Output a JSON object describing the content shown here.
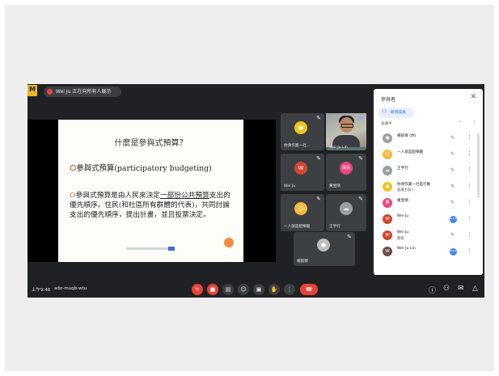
{
  "window": {
    "logo": "M",
    "presenting_label": "Wei Ju 正在向所有人展示"
  },
  "slide": {
    "title": "什麼是參與式預算？",
    "bullet1": "參與式預算(participatory budgeting)",
    "bullet2_a": "參與式預算是由人民來決定",
    "bullet2_link": "一部份公共預算",
    "bullet2_b": "支出的優先順序。住民(和社區所有群體的代表)，共同討論支出的優先順序，提出計畫，並且投票決定。"
  },
  "tiles": [
    {
      "name": "你滑作業一社...",
      "avatar": "",
      "avatar_color": "#f0c419"
    },
    {
      "name": "Wei-Ju Lin",
      "avatar": "",
      "avatar_color": ""
    },
    {
      "name": "Wei Ju",
      "avatar": "W",
      "avatar_color": "#d2472f"
    },
    {
      "name": "黃昱晴",
      "avatar": "黃昱",
      "avatar_color": "#e8467c"
    },
    {
      "name": "一人就是超樂趣",
      "avatar": "",
      "avatar_color": "#f6b93b"
    },
    {
      "name": "王宇行",
      "avatar": "",
      "avatar_color": "#9aa0a6"
    },
    {
      "name": "楊凱傑",
      "avatar": "",
      "avatar_color": "#bdbdbd"
    }
  ],
  "bottombar": {
    "time": "上午9:46",
    "meeting_code": "ado-muqb-wtu"
  },
  "controls": [
    "mic",
    "cam",
    "cc",
    "raise",
    "present",
    "hand",
    "more",
    "hangup"
  ],
  "participants_panel": {
    "title": "參與者",
    "add_label": "新增成員",
    "section_label": "會議中",
    "rows": [
      {
        "name": "楊凱傑 (你)",
        "sub": "",
        "avatar": "",
        "color": "#a0a0a0",
        "mic": "muted"
      },
      {
        "name": "一人就是超樂趣",
        "sub": "",
        "avatar": "",
        "color": "#f6b93b",
        "mic": "muted"
      },
      {
        "name": "王宇行",
        "sub": "",
        "avatar": "",
        "color": "#9aa0a6",
        "mic": "muted"
      },
      {
        "name": "你滑作業一社區行動",
        "sub": "會議主辦人",
        "avatar": "",
        "color": "#f0c419",
        "mic": "muted"
      },
      {
        "name": "黃昱晴",
        "sub": "",
        "avatar": "黃",
        "color": "#e8467c",
        "mic": "muted"
      },
      {
        "name": "Wei Ju",
        "sub": "",
        "avatar": "W",
        "color": "#d2472f",
        "mic": "active"
      },
      {
        "name": "Wei Ju",
        "sub": "簡報",
        "avatar": "W",
        "color": "#d2472f",
        "mic": "muted"
      },
      {
        "name": "Wei-Ju Lin",
        "sub": "",
        "avatar": "W",
        "color": "#6d4c41",
        "mic": "active"
      }
    ]
  }
}
